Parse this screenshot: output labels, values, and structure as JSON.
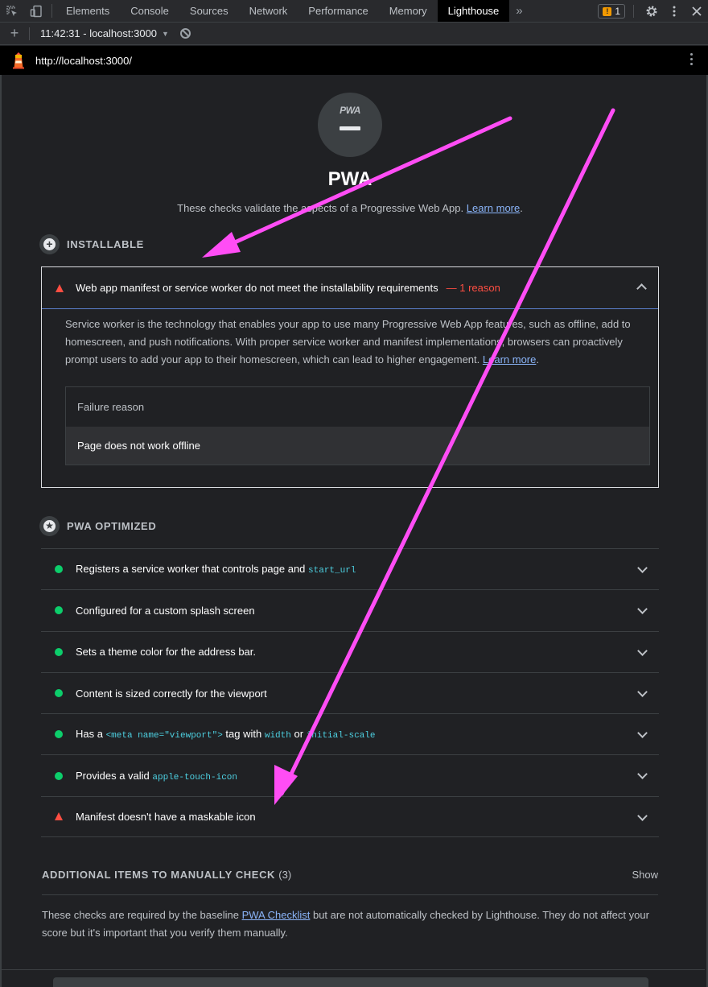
{
  "devtools": {
    "tabs": [
      "Elements",
      "Console",
      "Sources",
      "Network",
      "Performance",
      "Memory",
      "Lighthouse"
    ],
    "active_tab": "Lighthouse",
    "more_tabs": "»",
    "issues_count": "1"
  },
  "lighthouse_toolbar": {
    "add": "+",
    "report_label": "11:42:31 - localhost:3000",
    "caret": "▼"
  },
  "urlbar": {
    "url": "http://localhost:3000/"
  },
  "category": {
    "gauge_label": "PWA",
    "title": "PWA",
    "description": "These checks validate the aspects of a Progressive Web App.",
    "learn_more": "Learn more"
  },
  "installable": {
    "title": "INSTALLABLE",
    "audit_title": "Web app manifest or service worker do not meet the installability requirements",
    "reason": "— 1 reason",
    "description": "Service worker is the technology that enables your app to use many Progressive Web App features, such as offline, add to homescreen, and push notifications. With proper service worker and manifest implementations, browsers can proactively prompt users to add your app to their homescreen, which can lead to higher engagement.",
    "learn_more": "Learn more",
    "table_header": "Failure reason",
    "table_value": "Page does not work offline"
  },
  "optimized": {
    "title": "PWA OPTIMIZED",
    "audits": [
      {
        "status": "pass",
        "text": "Registers a service worker that controls page and ",
        "code": "start_url"
      },
      {
        "status": "pass",
        "text": "Configured for a custom splash screen"
      },
      {
        "status": "pass",
        "text": "Sets a theme color for the address bar."
      },
      {
        "status": "pass",
        "text": "Content is sized correctly for the viewport"
      },
      {
        "status": "pass",
        "t1": "Has a ",
        "c1": "<meta name=\"viewport\">",
        "t2": " tag with ",
        "c2": "width",
        "t3": " or ",
        "c3": "initial-scale"
      },
      {
        "status": "pass",
        "text": "Provides a valid ",
        "code": "apple-touch-icon"
      },
      {
        "status": "fail",
        "text": "Manifest doesn't have a maskable icon"
      }
    ]
  },
  "manual": {
    "title": "ADDITIONAL ITEMS TO MANUALLY CHECK",
    "count": "(3)",
    "show": "Show",
    "desc_1": "These checks are required by the baseline ",
    "checklist": "PWA Checklist",
    "desc_2": " but are not automatically checked by Lighthouse. They do not affect your score but it's important that you verify them manually."
  },
  "colors": {
    "pass": "#0cce6b",
    "fail": "#ff4e42",
    "link": "#8ab4f8",
    "code": "#4dd0e1",
    "annotation_arrow": "#ff4df5",
    "issue_badge": "#f29900"
  }
}
